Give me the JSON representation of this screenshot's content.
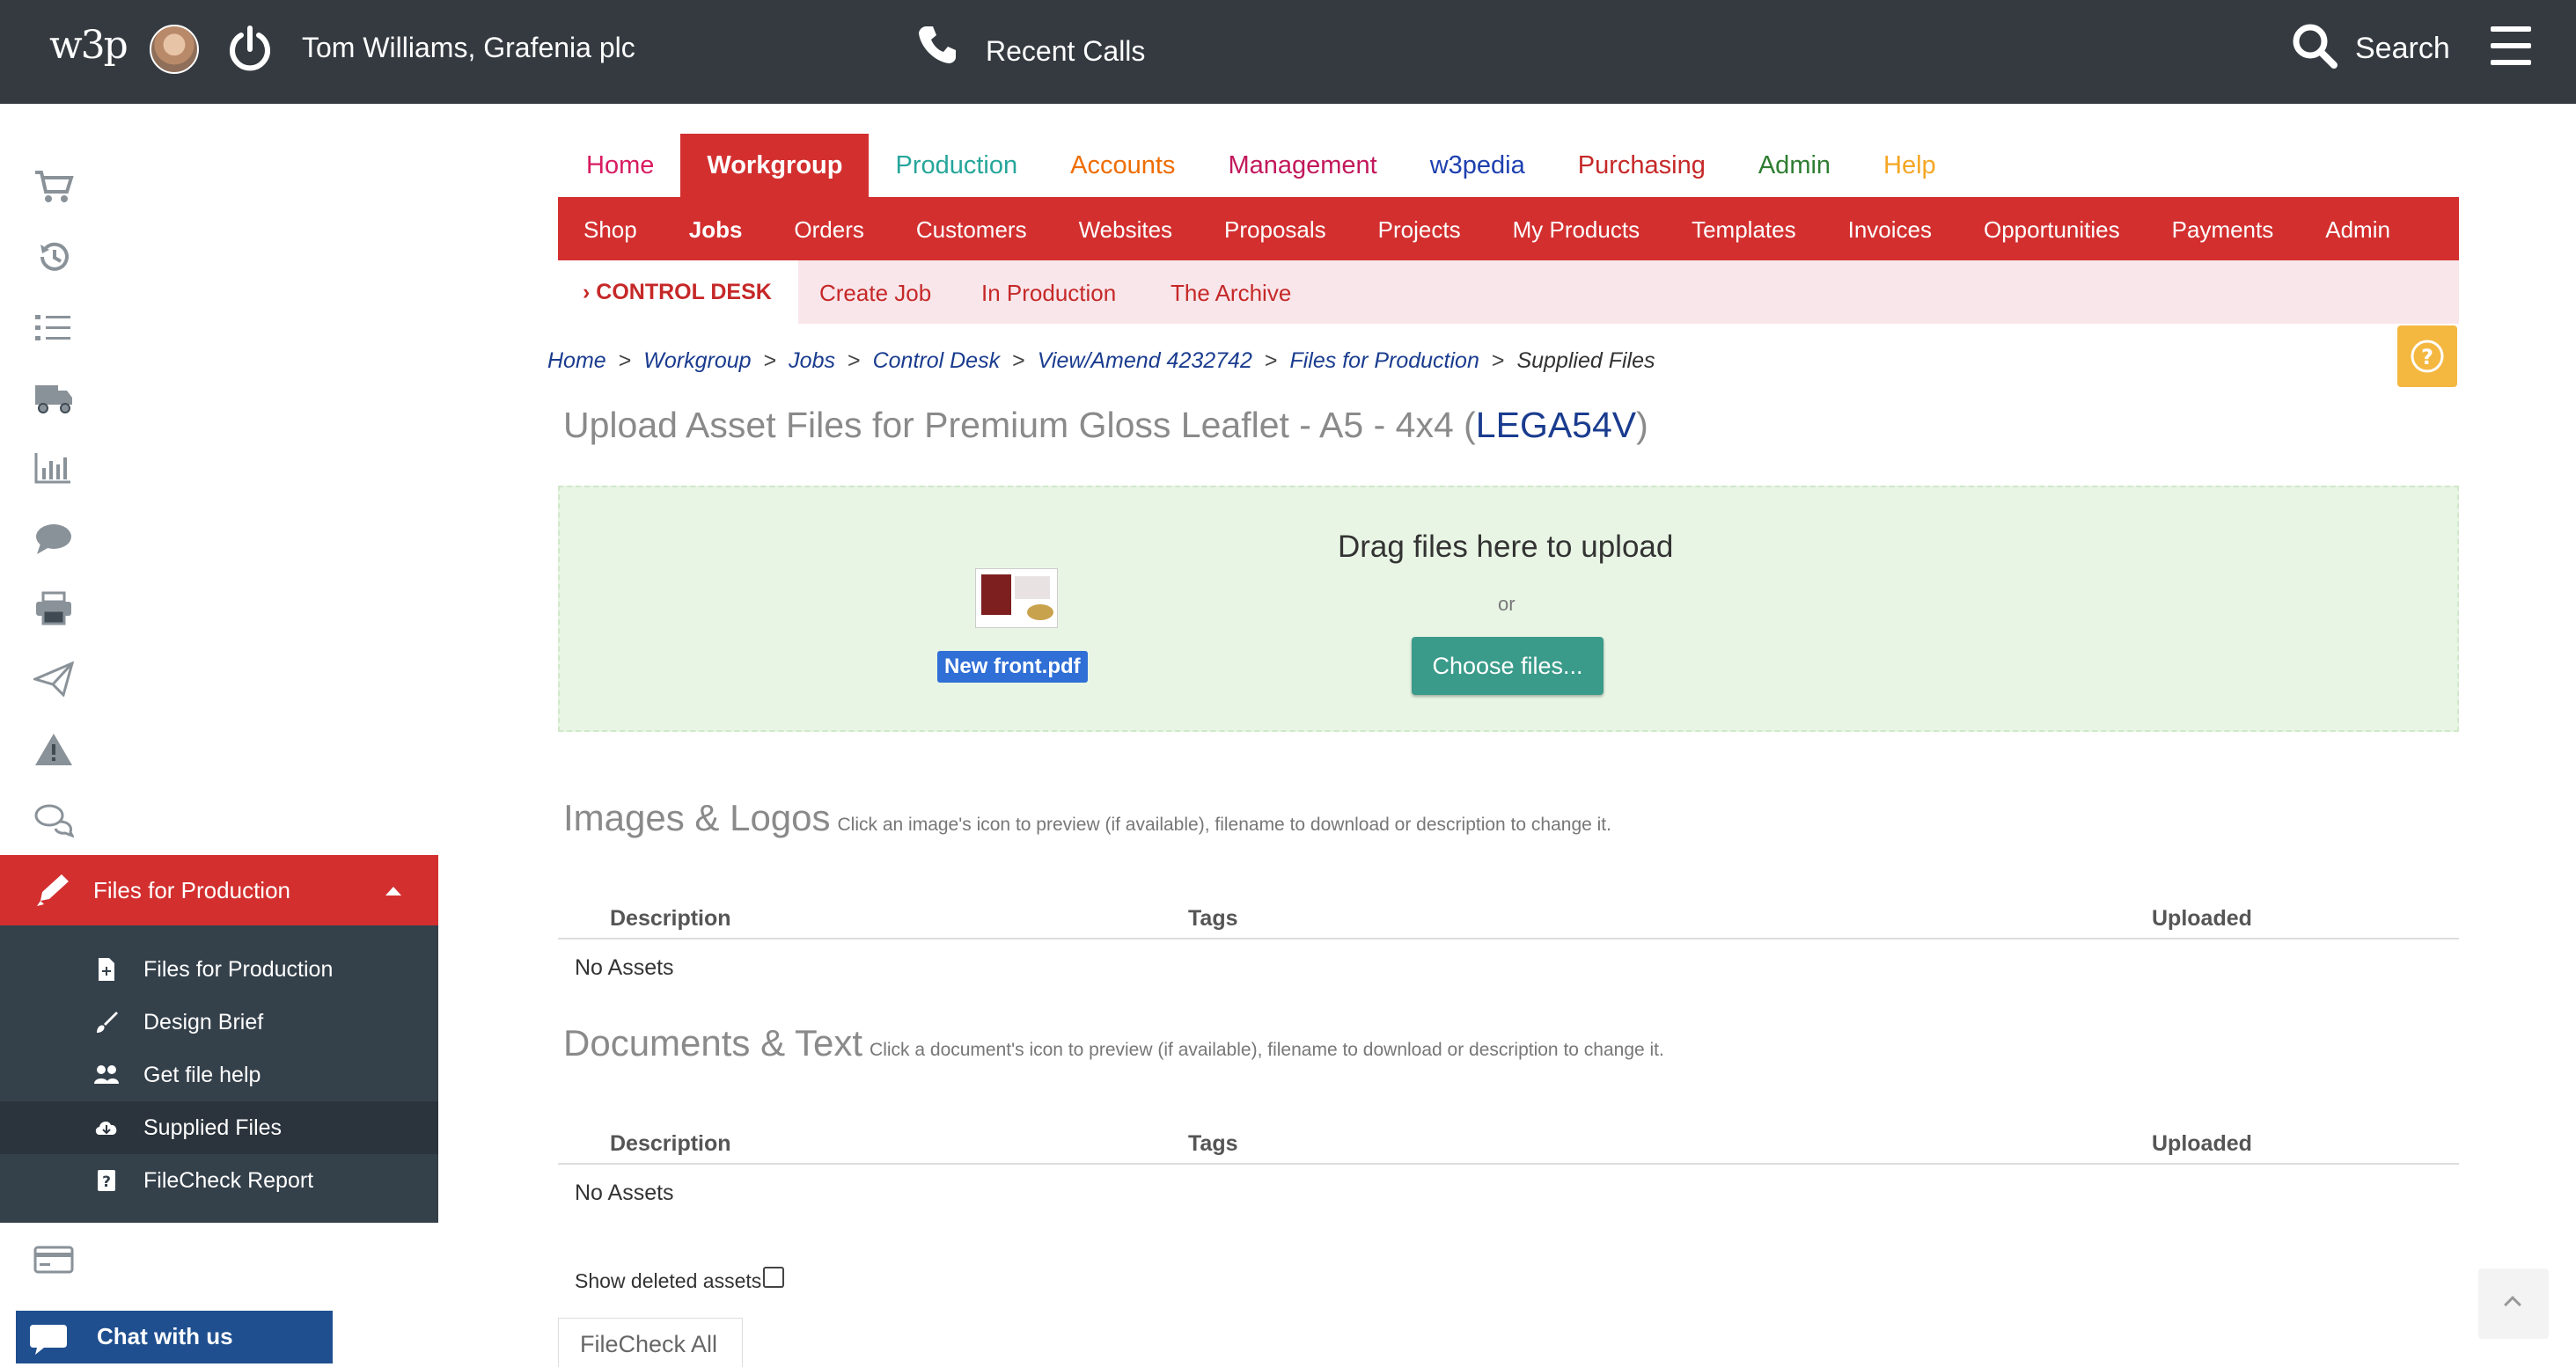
{
  "topbar": {
    "logo": "w3p",
    "user": "Tom Williams, Grafenia plc",
    "recent_calls": "Recent Calls",
    "search": "Search"
  },
  "sidebar": {
    "items": [
      {
        "label": "Job Summary",
        "icon": "cart-icon",
        "caret": false
      },
      {
        "label": "History",
        "icon": "history-icon",
        "caret": false
      },
      {
        "label": "Runs",
        "icon": "list-icon",
        "caret": false
      },
      {
        "label": "Despatch",
        "icon": "truck-icon",
        "caret": false
      },
      {
        "label": "Financial",
        "icon": "bar-chart-icon",
        "caret": true
      },
      {
        "label": "Notes",
        "icon": "speech-bubble-icon",
        "caret": true
      },
      {
        "label": "Printouts",
        "icon": "printer-icon",
        "caret": false
      },
      {
        "label": "Email & SMS",
        "icon": "paper-plane-icon",
        "caret": true
      },
      {
        "label": "Quality",
        "icon": "warning-icon",
        "caret": true
      },
      {
        "label": "Feedback",
        "icon": "comments-icon",
        "caret": true
      },
      {
        "label": "Files for Production",
        "icon": "pencil-icon",
        "caret": true,
        "active": true
      }
    ],
    "submenu": [
      {
        "label": "Files for Production",
        "icon": "file-plus-icon"
      },
      {
        "label": "Design Brief",
        "icon": "brush-icon"
      },
      {
        "label": "Get file help",
        "icon": "users-icon"
      },
      {
        "label": "Supplied Files",
        "icon": "cloud-download-icon",
        "active": true
      },
      {
        "label": "FileCheck Report",
        "icon": "question-box-icon"
      }
    ],
    "payments": "Payments",
    "chat": "Chat with us"
  },
  "nav": {
    "tabs": [
      {
        "label": "Home",
        "color": "#d81b60"
      },
      {
        "label": "Workgroup",
        "color": "#ffffff",
        "active": true
      },
      {
        "label": "Production",
        "color": "#26a69a"
      },
      {
        "label": "Accounts",
        "color": "#ef6c00"
      },
      {
        "label": "Management",
        "color": "#c2185b"
      },
      {
        "label": "w3pedia",
        "color": "#1e40af"
      },
      {
        "label": "Purchasing",
        "color": "#c62828"
      },
      {
        "label": "Admin",
        "color": "#2e7d32"
      },
      {
        "label": "Help",
        "color": "#f5a623"
      }
    ],
    "subnav": [
      "Shop",
      "Jobs",
      "Orders",
      "Customers",
      "Websites",
      "Proposals",
      "Projects",
      "My Products",
      "Templates",
      "Invoices",
      "Opportunities",
      "Payments",
      "Admin"
    ],
    "subnav_active": "Jobs",
    "third": [
      "› CONTROL DESK",
      "Create Job",
      "In Production",
      "The Archive"
    ]
  },
  "breadcrumbs": [
    "Home",
    "Workgroup",
    "Jobs",
    "Control Desk",
    "View/Amend 4232742",
    "Files for Production",
    "Supplied Files"
  ],
  "page": {
    "title_prefix": "Upload Asset Files for Premium Gloss Leaflet - A5 - 4x4 (",
    "title_code": "LEGA54V",
    "title_suffix": ")"
  },
  "upload": {
    "drag_text": "Drag files here to upload",
    "or": "or",
    "choose": "Choose files...",
    "file_name": "New front.pdf"
  },
  "images_section": {
    "title": "Images & Logos",
    "hint": "Click an image's icon to preview (if available), filename to download or description to change it.",
    "columns": [
      "Description",
      "Tags",
      "Uploaded"
    ],
    "empty": "No Assets"
  },
  "documents_section": {
    "title": "Documents & Text",
    "hint": "Click a document's icon to preview (if available), filename to download or description to change it.",
    "columns": [
      "Description",
      "Tags",
      "Uploaded"
    ],
    "empty": "No Assets"
  },
  "footer": {
    "show_deleted": "Show deleted assets",
    "filecheck_all": "FileCheck All"
  }
}
